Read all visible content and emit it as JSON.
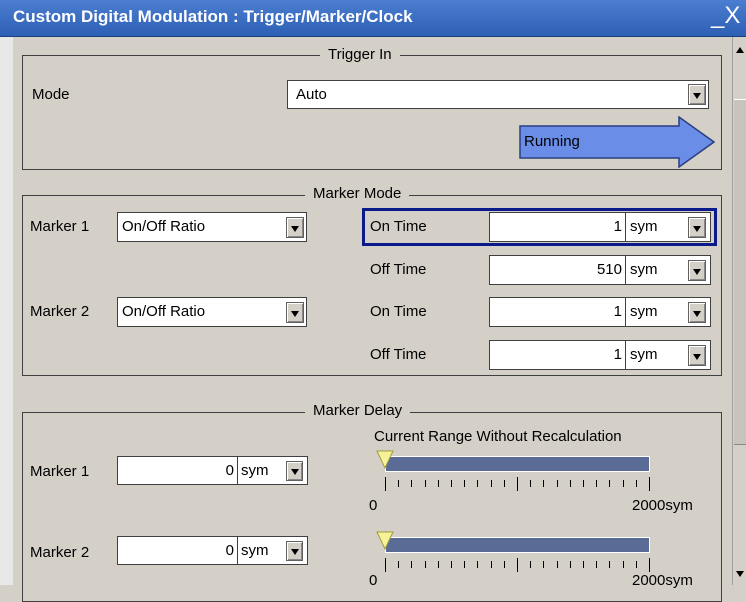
{
  "window": {
    "title": "Custom Digital Modulation : Trigger/Marker/Clock",
    "close_glyph": "_X"
  },
  "trigger_in": {
    "title": "Trigger In",
    "mode_label": "Mode",
    "mode_value": "Auto",
    "status": "Running",
    "status_color": "#6a8ee8"
  },
  "marker_mode": {
    "title": "Marker Mode",
    "markers": [
      {
        "label": "Marker 1",
        "mode": "On/Off Ratio"
      },
      {
        "label": "Marker 2",
        "mode": "On/Off Ratio"
      }
    ],
    "rows": [
      {
        "label": "On Time",
        "value": "1",
        "unit": "sym"
      },
      {
        "label": "Off Time",
        "value": "510",
        "unit": "sym"
      },
      {
        "label": "On Time",
        "value": "1",
        "unit": "sym"
      },
      {
        "label": "Off Time",
        "value": "1",
        "unit": "sym"
      }
    ],
    "focus_color": "#0a1a8a"
  },
  "marker_delay": {
    "title": "Marker Delay",
    "range_caption": "Current Range Without Recalculation",
    "markers": [
      {
        "label": "Marker 1",
        "value": "0",
        "unit": "sym",
        "range_min": "0",
        "range_max": "2000sym",
        "slider_fraction": 0
      },
      {
        "label": "Marker 2",
        "value": "0",
        "unit": "sym",
        "range_min": "0",
        "range_max": "2000sym",
        "slider_fraction": 0
      }
    ]
  }
}
